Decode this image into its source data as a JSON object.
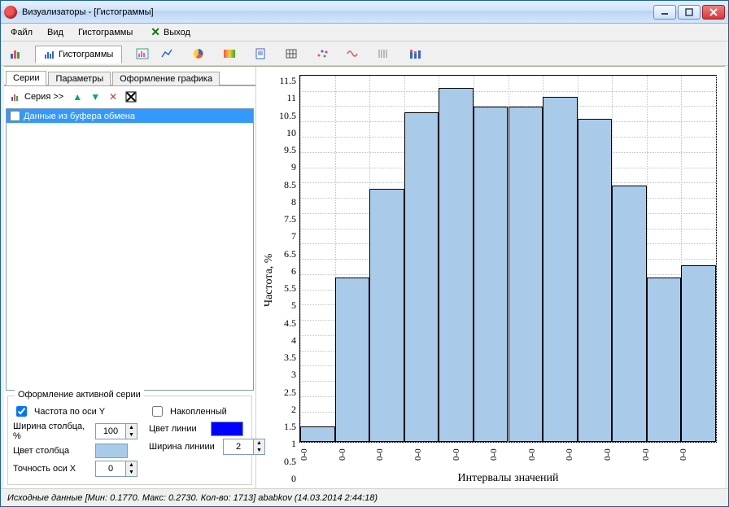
{
  "window": {
    "title": "Визуализаторы - [Гистограммы]"
  },
  "menu": {
    "file": "Файл",
    "view": "Вид",
    "histograms": "Гистограммы",
    "exit": "Выход"
  },
  "main_tabs": {
    "histograms": "Гистограммы"
  },
  "left": {
    "tabs": {
      "series": "Серии",
      "params": "Параметры",
      "style": "Оформление графика"
    },
    "series_btn": "Серия >>",
    "series_item": "Данные из буфера обмена",
    "fieldset_title": "Оформление активной серии",
    "freq_y": "Частота по оси Y",
    "accumulated": "Накопленный",
    "col_width_label": "Ширина столбца, %",
    "col_width_value": "100",
    "line_color_label": "Цвет линии",
    "col_color_label": "Цвет столбца",
    "line_width_label": "Ширина линиии",
    "line_width_value": "2",
    "precision_x_label": "Точность оси X",
    "precision_x_value": "0",
    "color_bar": "#a9cbe9",
    "color_line": "#0000ff"
  },
  "chart_data": {
    "type": "bar",
    "title": "",
    "xlabel": "Интервалы значений",
    "ylabel": "Частота, %",
    "categories": [
      "0-0",
      "0-0",
      "0-0",
      "0-0",
      "0-0",
      "0-0",
      "0-0",
      "0-0",
      "0-0",
      "0-0",
      "0-0"
    ],
    "values": [
      0.5,
      5.4,
      8.3,
      10.8,
      11.6,
      11.0,
      11.0,
      11.3,
      10.6,
      8.4,
      5.4,
      5.8
    ],
    "ylim": [
      0,
      12
    ],
    "yticks": [
      0,
      0.5,
      1,
      1.5,
      2,
      2.5,
      3,
      3.5,
      4,
      4.5,
      5,
      5.5,
      6,
      6.5,
      7,
      7.5,
      8,
      8.5,
      9,
      9.5,
      10,
      10.5,
      11,
      11.5
    ]
  },
  "status": "Исходные данные [Мин: 0.1770. Макс: 0.2730. Кол-во: 1713] ababkov (14.03.2014 2:44:18)"
}
